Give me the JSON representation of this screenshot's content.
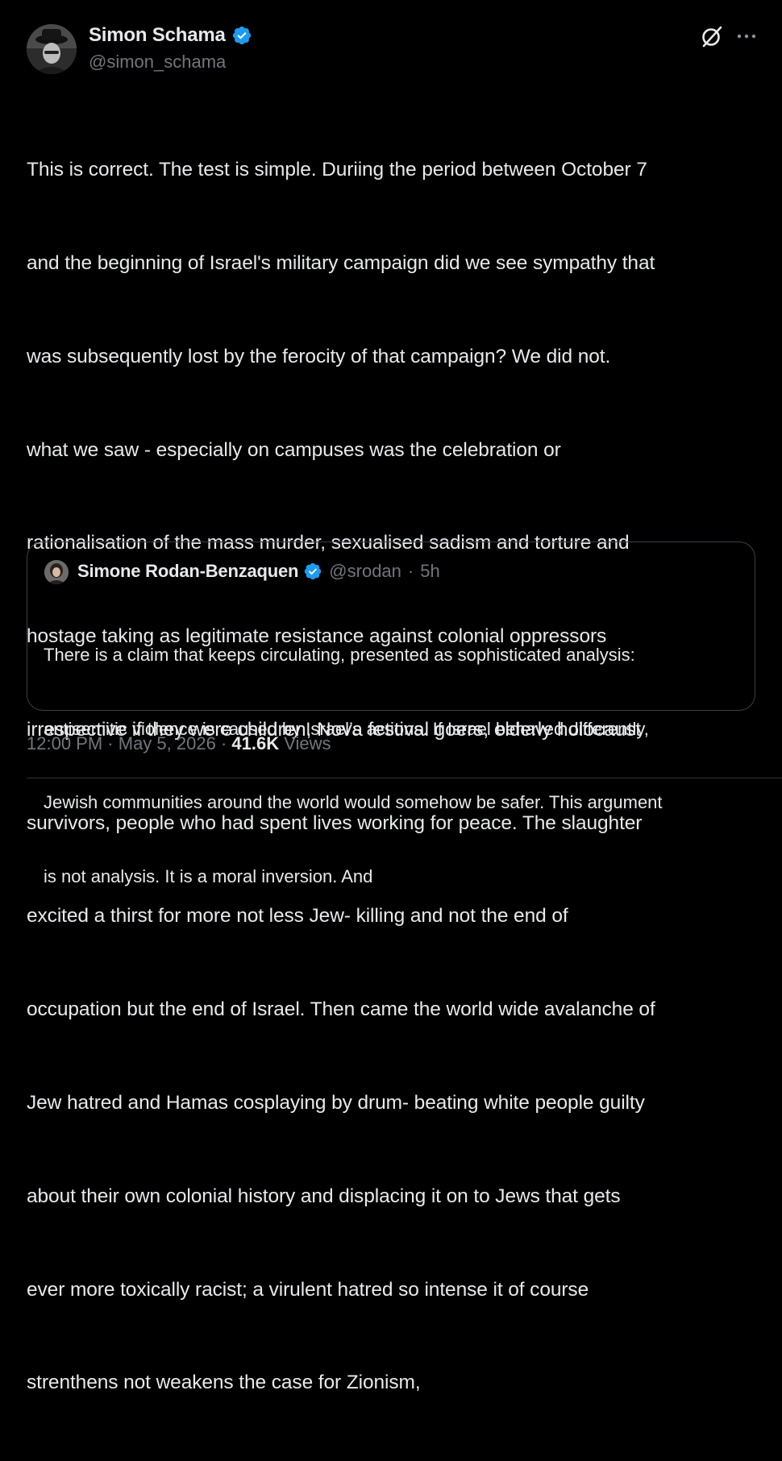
{
  "author": {
    "name": "Simon Schama",
    "handle": "@simon_schama",
    "verified_icon": "verified-badge-icon",
    "avatar_icon": "avatar-photo"
  },
  "header_actions": [
    {
      "name": "grok-icon"
    },
    {
      "name": "more-options-icon"
    }
  ],
  "post": {
    "lines": [
      "This is correct. The test is simple. Duriing the period between October 7",
      "and the beginning of Israel's military campaign did we see sympathy that",
      "was subsequently lost by the ferocity of that campaign? We did not.",
      "what we saw - especially on campuses was the celebration or",
      "rationalisation of the mass murder, sexualised sadism and torture and",
      "hostage taking as legitimate resistance against colonial oppressors",
      "irrespective if they were children, Nova festival goers, elderly holocaust",
      "survivors, people who had spent lives working for peace. The slaughter",
      "excited a thirst for more not less Jew- killing and not the end of",
      "occupation but the end of Israel. Then came the world wide avalanche of",
      "Jew hatred and Hamas cosplaying by drum- beating white people guilty",
      "about their own colonial history and displacing it on to Jews that gets",
      "ever more toxically racist; a virulent hatred so intense it of course",
      "strenthens not weakens the case for Zionism,"
    ]
  },
  "quote": {
    "name": "Simone Rodan-Benzaquen",
    "handle": "@srodan",
    "separator": "·",
    "time": "5h",
    "lines": [
      "There is a claim that keeps circulating, presented as sophisticated analysis:",
      "antisemitic violence is caused by Israel’s actions. If Israel behaved differently,",
      "Jewish communities around the world would somehow be safer. This argument",
      "is not analysis. It is a moral inversion. And"
    ]
  },
  "footer": {
    "time": "12:00 PM",
    "sep1": "·",
    "date": "May 5, 2026",
    "sep2": "·",
    "views_count": "41.6K",
    "views_label": "Views"
  },
  "colors": {
    "background": "#000000",
    "text": "#e7e9ea",
    "muted": "#71767b",
    "verified_blue": "#1d9bf0",
    "border": "#3b3f44"
  }
}
